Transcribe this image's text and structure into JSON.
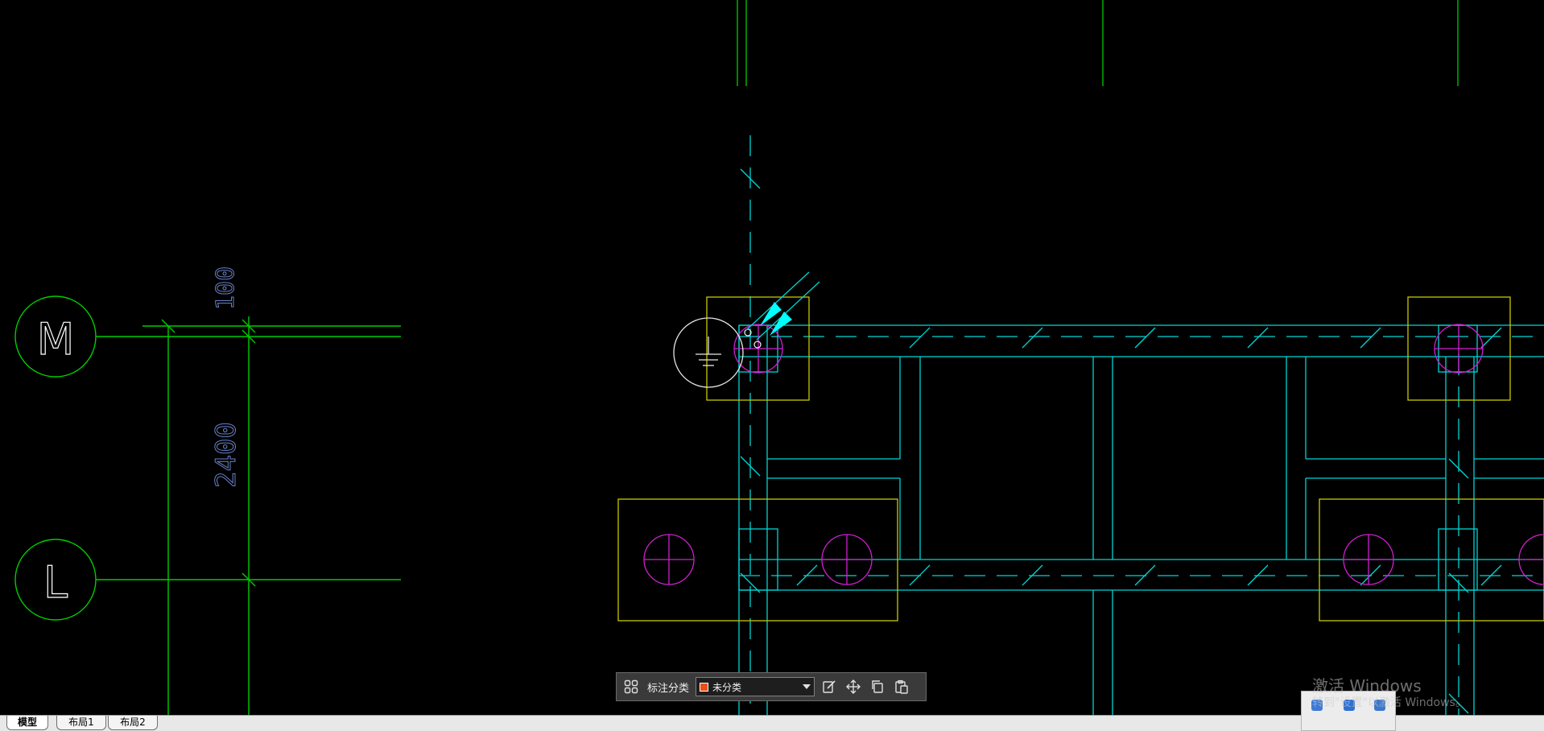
{
  "drawing": {
    "axis_labels": {
      "m": "M",
      "l": "L"
    },
    "dimensions": {
      "top": "100",
      "main": "2400"
    }
  },
  "toolbar": {
    "label": "标注分类",
    "category_value": "未分类",
    "category_color": "#e8501a",
    "icons": [
      "grid-icon",
      "edit-icon",
      "move-icon",
      "copy-icon",
      "paste-icon"
    ]
  },
  "tabs": [
    {
      "label": "模型",
      "active": true
    },
    {
      "label": "布局1",
      "active": false
    },
    {
      "label": "布局2",
      "active": false
    }
  ],
  "watermark": {
    "title": "激活 Windows",
    "subtitle": "转到\"设置\"以激活 Windows。"
  },
  "colors": {
    "background": "#000000",
    "axis_green": "#00cc00",
    "cyan": "#00d5d5",
    "yellow": "#c8c800",
    "magenta": "#d020d0",
    "dim_text": "#6a82c8"
  }
}
